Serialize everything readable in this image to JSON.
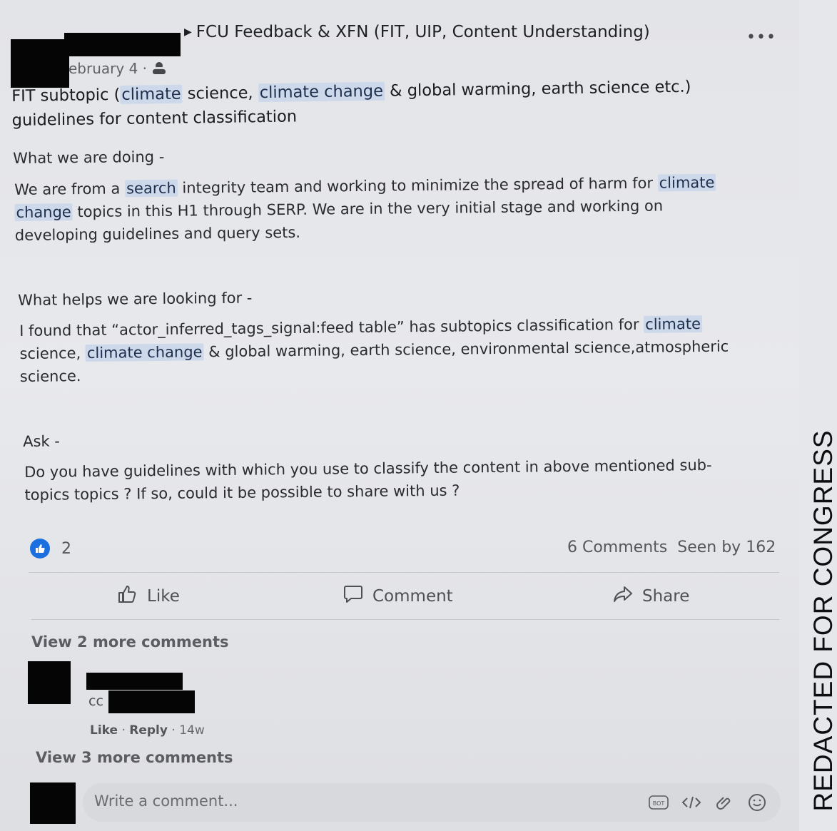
{
  "post": {
    "group_name": "FCU Feedback & XFN (FIT, UIP, Content Understanding)",
    "date": "February 4 ·",
    "date_visible": "ebruary 4 ·",
    "audience_icon": "group-audience-icon",
    "more_icon": "•••",
    "title_parts": [
      "FIT subtopic (",
      "climate",
      " science, ",
      "climate change",
      " & global warming, earth science etc.)"
    ],
    "title_line2": "guidelines for content classification",
    "s1_heading": "What we are doing -",
    "s1_l1": [
      "We are from a ",
      "search",
      " integrity team and working to minimize the spread of harm for ",
      "climate"
    ],
    "s1_l2": [
      "change",
      " topics in this H1 through SERP. We are in the very initial stage and working on"
    ],
    "s1_l3": "developing guidelines and query sets.",
    "s2_heading": "What helps we are looking for -",
    "s2_l1": [
      "I found that “actor_inferred_tags_signal:feed table” has subtopics classification for ",
      "climate"
    ],
    "s2_l2": [
      "science, ",
      "climate change",
      " & global warming, earth science, environmental science,atmospheric"
    ],
    "s2_l3": "science.",
    "s3_heading": "Ask -",
    "s3_l1": "Do you have guidelines with which you use to classify the content in above mentioned sub-",
    "s3_l2": "topics topics ? If so, could it be possible to share with us ?"
  },
  "reactions": {
    "count": "2",
    "comments": "6 Comments",
    "seen": "Seen by 162"
  },
  "actions": {
    "like": "Like",
    "comment": "Comment",
    "share": "Share"
  },
  "comments": {
    "view_more_1": "View 2 more comments",
    "comment_text": "cc",
    "like": "Like",
    "sep1": "·",
    "reply": "Reply",
    "sep2": "·",
    "time": "14w",
    "view_more_2": "View 3 more comments"
  },
  "composer": {
    "placeholder": "Write a comment..."
  },
  "watermark": "REDACTED FOR CONGRESS",
  "colors": {
    "highlight": "#cdd9ea",
    "like_blue": "#1b6fe0",
    "redaction": "#050505"
  }
}
